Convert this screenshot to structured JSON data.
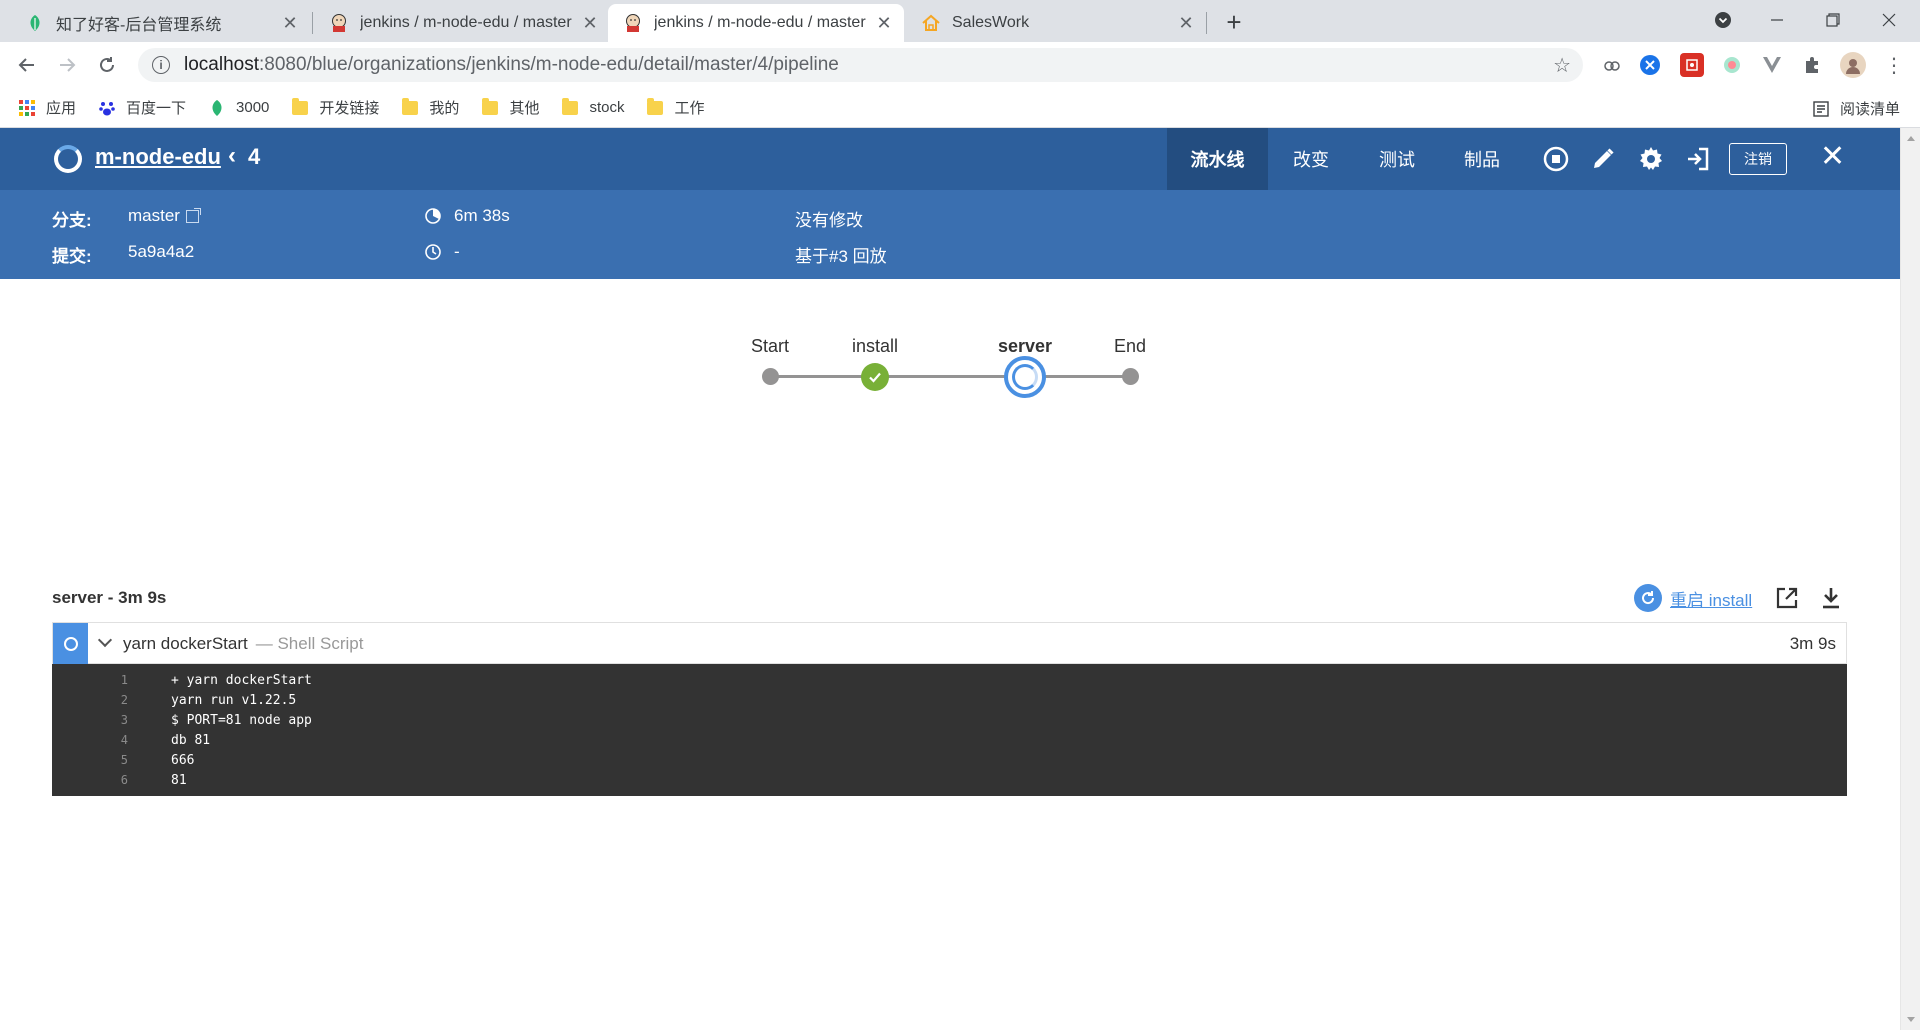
{
  "browser": {
    "tabs": [
      {
        "title": "知了好客-后台管理系统",
        "icon": "leaf-icon",
        "active": false
      },
      {
        "title": "jenkins / m-node-edu / master",
        "icon": "jenkins-icon",
        "active": false
      },
      {
        "title": "jenkins / m-node-edu / master",
        "icon": "jenkins-icon",
        "active": true
      },
      {
        "title": "SalesWork",
        "icon": "home-icon",
        "active": false
      }
    ],
    "url_host": "localhost",
    "url_path": ":8080/blue/organizations/jenkins/m-node-edu/detail/master/4/pipeline",
    "bookmarks": [
      {
        "label": "应用",
        "icon": "apps-grid-icon"
      },
      {
        "label": "百度一下",
        "icon": "baidu-paw-icon"
      },
      {
        "label": "3000",
        "icon": "leaf-icon"
      },
      {
        "label": "开发链接",
        "icon": "folder-icon"
      },
      {
        "label": "我的",
        "icon": "folder-icon"
      },
      {
        "label": "其他",
        "icon": "folder-icon"
      },
      {
        "label": "stock",
        "icon": "folder-icon"
      },
      {
        "label": "工作",
        "icon": "folder-icon"
      }
    ],
    "reading_list": "阅读清单"
  },
  "header": {
    "pipeline_name": "m-node-edu",
    "run_number": "4",
    "tabs": [
      {
        "label": "流水线",
        "active": true
      },
      {
        "label": "改变",
        "active": false
      },
      {
        "label": "测试",
        "active": false
      },
      {
        "label": "制品",
        "active": false
      }
    ],
    "logout_label": "注销",
    "colors": {
      "header_bg": "#2d5f9c",
      "summary_bg": "#3a6fb0",
      "running": "#4a90e2",
      "success": "#78b037"
    }
  },
  "summary": {
    "branch_label": "分支:",
    "branch_value": "master",
    "commit_label": "提交:",
    "commit_value": "5a9a4a2",
    "duration": "6m 38s",
    "time_ago": "-",
    "changes": "没有修改",
    "replay_of": "基于#3 回放"
  },
  "pipeline": {
    "stages": [
      {
        "name": "Start",
        "status": "start"
      },
      {
        "name": "install",
        "status": "success"
      },
      {
        "name": "server",
        "status": "running"
      },
      {
        "name": "End",
        "status": "end"
      }
    ]
  },
  "log": {
    "title": "server - 3m 9s",
    "restart_label": "重启 install",
    "step": {
      "name": "yarn dockerStart",
      "type": "— Shell Script",
      "duration": "3m 9s"
    },
    "lines": [
      {
        "n": "1",
        "text": "+ yarn dockerStart"
      },
      {
        "n": "2",
        "text": "yarn run v1.22.5"
      },
      {
        "n": "3",
        "text": "$ PORT=81 node app"
      },
      {
        "n": "4",
        "text": "db 81"
      },
      {
        "n": "5",
        "text": "666"
      },
      {
        "n": "6",
        "text": "81"
      }
    ]
  }
}
